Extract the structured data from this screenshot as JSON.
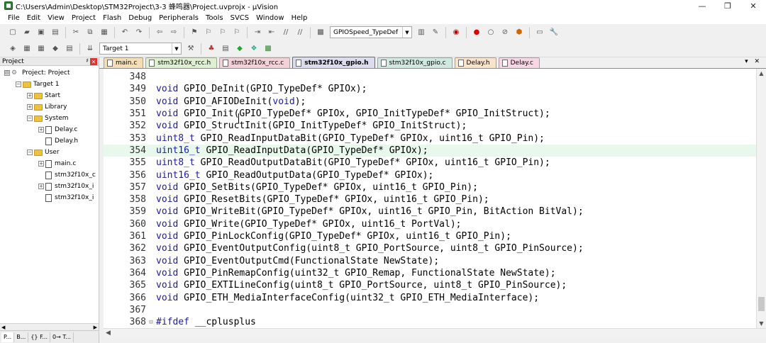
{
  "window": {
    "title": "C:\\Users\\Admin\\Desktop\\STM32Project\\3-3 蜂鸣器\\Project.uvprojx - µVision",
    "controls": {
      "minimize": "—",
      "maximize": "❐",
      "close": "✕"
    }
  },
  "menu": [
    "File",
    "Edit",
    "View",
    "Project",
    "Flash",
    "Debug",
    "Peripherals",
    "Tools",
    "SVCS",
    "Window",
    "Help"
  ],
  "toolbar": {
    "find_combo": "GPIOSpeed_TypeDef",
    "target_combo": "Target 1"
  },
  "watermark": "",
  "project_panel": {
    "title": "Project",
    "pin": "♯",
    "close": "✕",
    "tree": [
      {
        "label": "Project: Project",
        "level": 0,
        "expander": "⊟",
        "icon": "project"
      },
      {
        "label": "Target 1",
        "level": 1,
        "expander": "−",
        "icon": "folder"
      },
      {
        "label": "Start",
        "level": 2,
        "expander": "+",
        "icon": "folder"
      },
      {
        "label": "Library",
        "level": 2,
        "expander": "+",
        "icon": "folder"
      },
      {
        "label": "System",
        "level": 2,
        "expander": "−",
        "icon": "folder"
      },
      {
        "label": "Delay.c",
        "level": 3,
        "expander": "+",
        "icon": "file"
      },
      {
        "label": "Delay.h",
        "level": 3,
        "expander": "",
        "icon": "file"
      },
      {
        "label": "User",
        "level": 2,
        "expander": "−",
        "icon": "folder"
      },
      {
        "label": "main.c",
        "level": 3,
        "expander": "+",
        "icon": "file"
      },
      {
        "label": "stm32f10x_c",
        "level": 3,
        "expander": "",
        "icon": "file"
      },
      {
        "label": "stm32f10x_i",
        "level": 3,
        "expander": "+",
        "icon": "file"
      },
      {
        "label": "stm32f10x_i",
        "level": 3,
        "expander": "",
        "icon": "file"
      }
    ],
    "tabs": [
      "P...",
      "B...",
      "{} F...",
      "0→ T..."
    ]
  },
  "editor_tabs": [
    {
      "label": "main.c",
      "color": "#f5deb3",
      "active": false
    },
    {
      "label": "stm32f10x_rcc.h",
      "color": "#dff0d0",
      "active": false
    },
    {
      "label": "stm32f10x_rcc.c",
      "color": "#f4d0d8",
      "active": false
    },
    {
      "label": "stm32f10x_gpio.h",
      "color": "#dcdcf0",
      "active": true
    },
    {
      "label": "stm32f10x_gpio.c",
      "color": "#cfe9e0",
      "active": false
    },
    {
      "label": "Delay.h",
      "color": "#fbe3c9",
      "active": false
    },
    {
      "label": "Delay.c",
      "color": "#f9d6e4",
      "active": false
    }
  ],
  "tab_menu": "▾ ✕",
  "code_lines": [
    {
      "num": "348",
      "fold": "",
      "text": ""
    },
    {
      "num": "349",
      "fold": "",
      "text": "void GPIO_DeInit(GPIO_TypeDef* GPIOx);"
    },
    {
      "num": "350",
      "fold": "",
      "text": "void GPIO_AFIODeInit(void);"
    },
    {
      "num": "351",
      "fold": "",
      "text": "void GPIO_Init(GPIO_TypeDef* GPIOx, GPIO_InitTypeDef* GPIO_InitStruct);"
    },
    {
      "num": "352",
      "fold": "",
      "text": "void GPIO_StructInit(GPIO_InitTypeDef* GPIO_InitStruct);"
    },
    {
      "num": "353",
      "fold": "",
      "text": "uint8_t GPIO_ReadInputDataBit(GPIO_TypeDef* GPIOx, uint16_t GPIO_Pin);"
    },
    {
      "num": "354",
      "fold": "",
      "text": "uint16_t GPIO_ReadInputData(GPIO_TypeDef* GPIOx);",
      "highlight": true
    },
    {
      "num": "355",
      "fold": "",
      "text": "uint8_t GPIO_ReadOutputDataBit(GPIO_TypeDef* GPIOx, uint16_t GPIO_Pin);"
    },
    {
      "num": "356",
      "fold": "",
      "text": "uint16_t GPIO_ReadOutputData(GPIO_TypeDef* GPIOx);"
    },
    {
      "num": "357",
      "fold": "",
      "text": "void GPIO_SetBits(GPIO_TypeDef* GPIOx, uint16_t GPIO_Pin);"
    },
    {
      "num": "358",
      "fold": "",
      "text": "void GPIO_ResetBits(GPIO_TypeDef* GPIOx, uint16_t GPIO_Pin);"
    },
    {
      "num": "359",
      "fold": "",
      "text": "void GPIO_WriteBit(GPIO_TypeDef* GPIOx, uint16_t GPIO_Pin, BitAction BitVal);"
    },
    {
      "num": "360",
      "fold": "",
      "text": "void GPIO_Write(GPIO_TypeDef* GPIOx, uint16_t PortVal);"
    },
    {
      "num": "361",
      "fold": "",
      "text": "void GPIO_PinLockConfig(GPIO_TypeDef* GPIOx, uint16_t GPIO_Pin);"
    },
    {
      "num": "362",
      "fold": "",
      "text": "void GPIO_EventOutputConfig(uint8_t GPIO_PortSource, uint8_t GPIO_PinSource);"
    },
    {
      "num": "363",
      "fold": "",
      "text": "void GPIO_EventOutputCmd(FunctionalState NewState);"
    },
    {
      "num": "364",
      "fold": "",
      "text": "void GPIO_PinRemapConfig(uint32_t GPIO_Remap, FunctionalState NewState);"
    },
    {
      "num": "365",
      "fold": "",
      "text": "void GPIO_EXTILineConfig(uint8_t GPIO_PortSource, uint8_t GPIO_PinSource);"
    },
    {
      "num": "366",
      "fold": "",
      "text": "void GPIO_ETH_MediaInterfaceConfig(uint32_t GPIO_ETH_MediaInterface);"
    },
    {
      "num": "367",
      "fold": "",
      "text": ""
    },
    {
      "num": "368",
      "fold": "⊟",
      "text": "#ifdef __cplusplus"
    }
  ],
  "colors": {
    "keyword": "#1a1aa6",
    "line_highlight": "#e8f8ec",
    "folder": "#f0c040"
  }
}
